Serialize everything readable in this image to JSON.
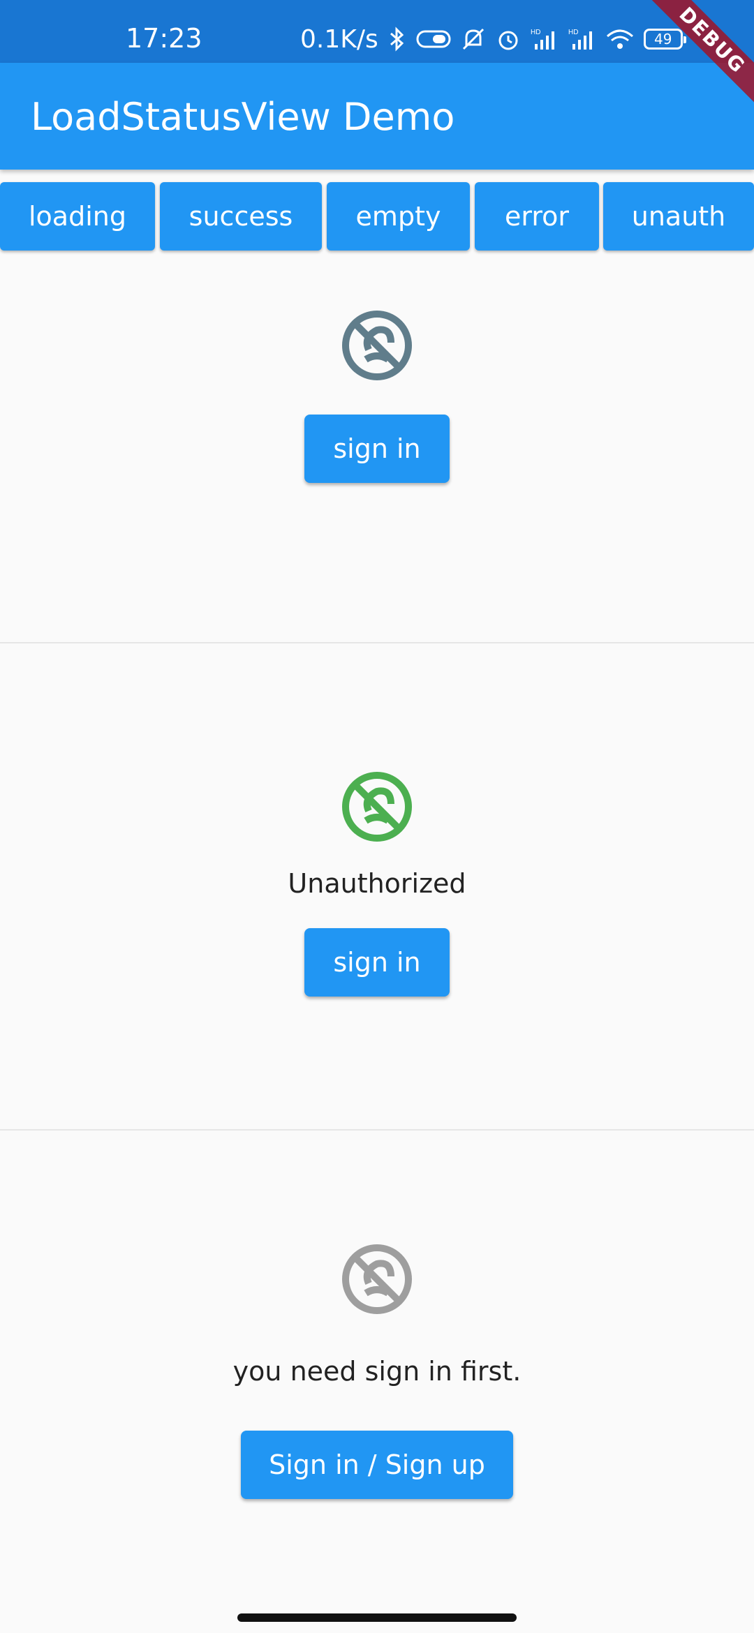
{
  "status_bar": {
    "time": "17:23",
    "net_speed": "0.1K/s",
    "battery": "49",
    "icons": [
      "bluetooth-icon",
      "vpn-key-icon",
      "mute-icon",
      "alarm-icon",
      "hd-signal-icon",
      "hd-signal-icon",
      "wifi-icon",
      "battery-icon"
    ]
  },
  "debug_banner": "DEBUG",
  "app_bar": {
    "title": "LoadStatusView Demo"
  },
  "buttons": [
    {
      "label": "loading"
    },
    {
      "label": "success"
    },
    {
      "label": "empty"
    },
    {
      "label": "error"
    },
    {
      "label": "unauth"
    }
  ],
  "panels": [
    {
      "icon": "unauthorized-icon",
      "icon_color": "#607d8b",
      "message": "",
      "button_label": "sign in"
    },
    {
      "icon": "unauthorized-icon",
      "icon_color": "#4caf50",
      "message": "Unauthorized",
      "button_label": "sign in"
    },
    {
      "icon": "unauthorized-icon",
      "icon_color": "#9e9e9e",
      "message": "you need sign in first.",
      "button_label": "Sign in / Sign up"
    }
  ],
  "colors": {
    "primary": "#2196f3",
    "status_bar": "#1976d2",
    "background": "#fafafa"
  }
}
